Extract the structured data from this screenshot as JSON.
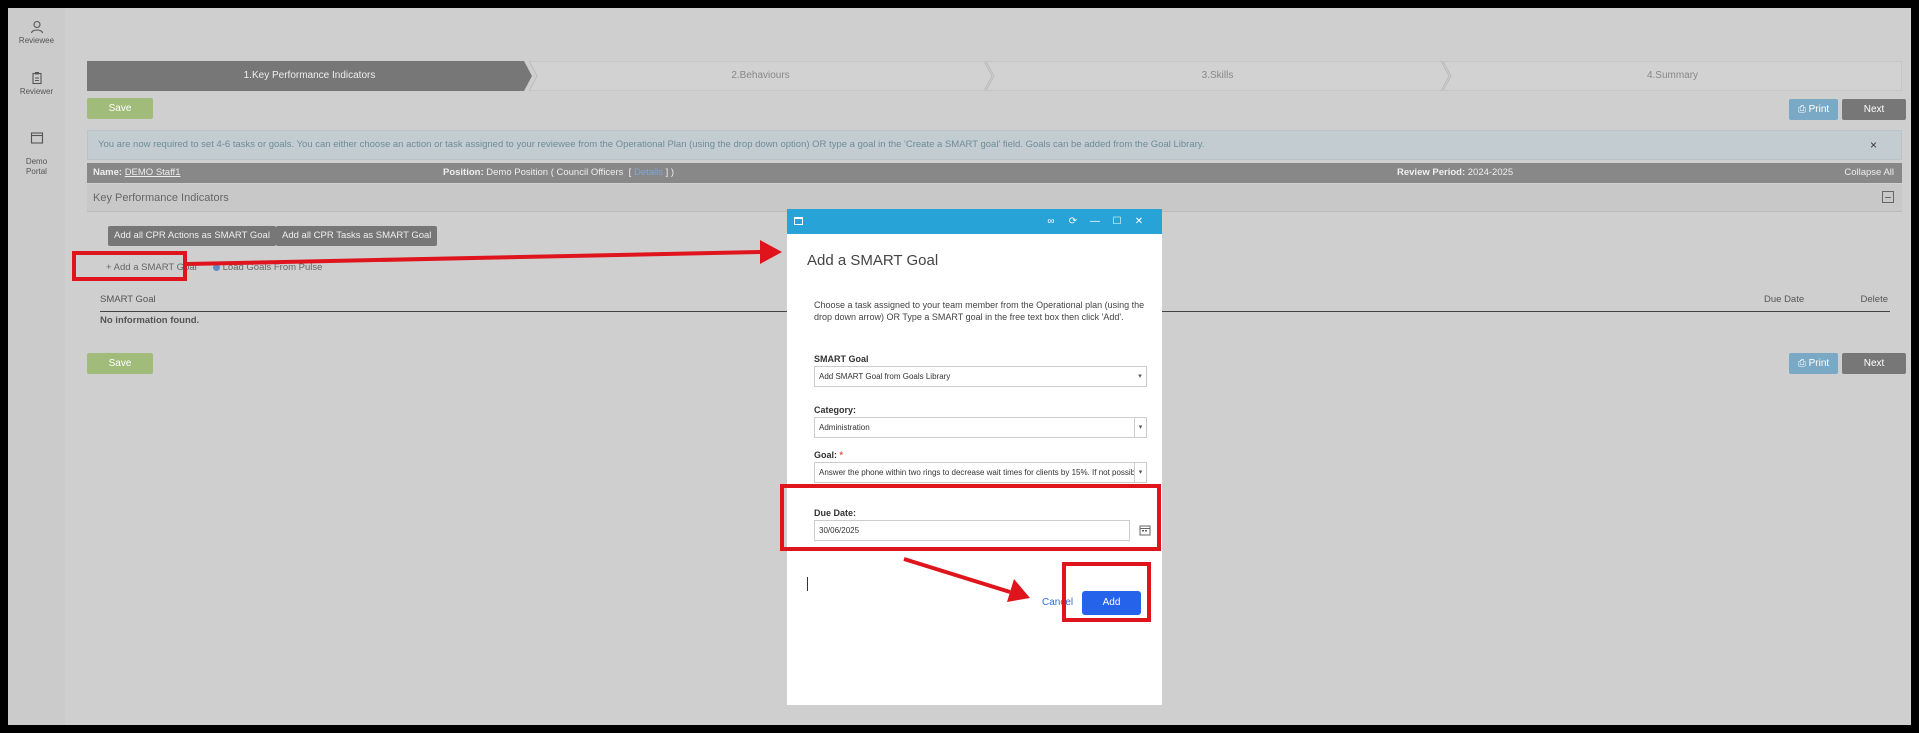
{
  "sidebar": {
    "items": [
      {
        "label": "Reviewee",
        "icon": "person-icon"
      },
      {
        "label": "Reviewer",
        "icon": "clipboard-icon"
      },
      {
        "label": "Demo\nPortal",
        "icon": "window-icon"
      }
    ]
  },
  "steps": [
    {
      "label": "1.Key Performance Indicators",
      "active": true
    },
    {
      "label": "2.Behaviours",
      "active": false
    },
    {
      "label": "3.Skills",
      "active": false
    },
    {
      "label": "4.Summary",
      "active": false
    }
  ],
  "toolbar": {
    "save": "Save",
    "print": "Print",
    "next": "Next"
  },
  "info": {
    "text": "You are now required to set 4-6 tasks or goals. You can either choose an action or task assigned to your reviewee from the Operational Plan (using the drop down option) OR type a goal in the 'Create a SMART goal' field. Goals can be added from the Goal Library.",
    "close": "×"
  },
  "namebar": {
    "name_label": "Name:",
    "name_value": "DEMO Staff1",
    "position_label": "Position:",
    "position_value": "Demo Position ( Council Officers",
    "position_link": "Details",
    "position_close": "] )",
    "position_open": "[",
    "period_label": "Review Period:",
    "period_value": "2024-2025",
    "collapse": "Collapse All"
  },
  "kpi": {
    "header": "Key Performance Indicators",
    "add_actions": "Add all CPR Actions as SMART Goal",
    "add_tasks": "Add all CPR Tasks as SMART Goal",
    "add_smart": "+ Add a SMART Goal",
    "load_pulse": "Load Goals From Pulse",
    "columns": {
      "goal": "SMART Goal",
      "due": "Due Date",
      "delete": "Delete"
    },
    "empty": "No information found."
  },
  "modal": {
    "title": "Add a SMART Goal",
    "description": "Choose a task assigned to your team member from the Operational plan (using the drop down arrow) OR Type a SMART goal in the free text box then click 'Add'.",
    "smart_goal_label": "SMART Goal",
    "smart_goal_value": "Add SMART Goal from Goals Library",
    "category_label": "Category:",
    "category_value": "Administration",
    "goal_label": "Goal:",
    "goal_required": "*",
    "goal_value": "Answer the phone within two rings to decrease wait times for clients by 15%. If not possible",
    "due_label": "Due Date:",
    "due_value": "30/06/2025",
    "cancel": "Cancel",
    "add": "Add"
  },
  "colors": {
    "highlight": "#e0141c",
    "primary": "#2563eb",
    "titlebar": "#27a3d8"
  }
}
